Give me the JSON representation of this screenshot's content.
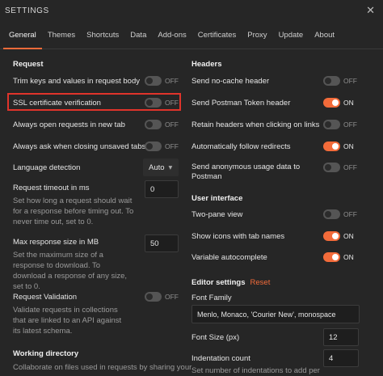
{
  "window": {
    "title": "SETTINGS",
    "close": "✕"
  },
  "tabs": [
    {
      "label": "General"
    },
    {
      "label": "Themes"
    },
    {
      "label": "Shortcuts"
    },
    {
      "label": "Data"
    },
    {
      "label": "Add-ons"
    },
    {
      "label": "Certificates"
    },
    {
      "label": "Proxy"
    },
    {
      "label": "Update"
    },
    {
      "label": "About"
    }
  ],
  "left": {
    "request_heading": "Request",
    "trim_keys": {
      "label": "Trim keys and values in request body",
      "state": "OFF"
    },
    "ssl": {
      "label": "SSL certificate verification",
      "state": "OFF"
    },
    "open_new_tab": {
      "label": "Always open requests in new tab",
      "state": "OFF"
    },
    "ask_closing": {
      "label": "Always ask when closing unsaved tabs",
      "state": "OFF"
    },
    "language_detection": {
      "label": "Language detection",
      "value": "Auto",
      "arrow": "▾"
    },
    "timeout": {
      "label": "Request timeout in ms",
      "desc": "Set how long a request should wait for a response before timing out. To never time out, set to 0.",
      "value": "0"
    },
    "max_response": {
      "label": "Max response size in MB",
      "desc": "Set the maximum size of a response to download. To download a response of any size, set to 0.",
      "value": "50"
    },
    "validation": {
      "label": "Request Validation",
      "desc": "Validate requests in collections that are linked to an API against its latest schema.",
      "state": "OFF"
    },
    "working_dir_heading": "Working directory",
    "working_dir_desc": "Collaborate on files used in requests by sharing your"
  },
  "right": {
    "headers_heading": "Headers",
    "no_cache": {
      "label": "Send no-cache header",
      "state": "OFF"
    },
    "postman_token": {
      "label": "Send Postman Token header",
      "state": "ON"
    },
    "retain_headers": {
      "label": "Retain headers when clicking on links",
      "state": "OFF"
    },
    "follow_redirects": {
      "label": "Automatically follow redirects",
      "state": "ON"
    },
    "anonymous_usage": {
      "label": "Send anonymous usage data to Postman",
      "state": "OFF"
    },
    "ui_heading": "User interface",
    "two_pane": {
      "label": "Two-pane view",
      "state": "OFF"
    },
    "show_icons": {
      "label": "Show icons with tab names",
      "state": "ON"
    },
    "variable_autocomplete": {
      "label": "Variable autocomplete",
      "state": "ON"
    },
    "editor_heading": "Editor settings",
    "reset_label": "Reset",
    "font_family": {
      "label": "Font Family",
      "value": "Menlo, Monaco, 'Courier New', monospace"
    },
    "font_size": {
      "label": "Font Size (px)",
      "value": "12"
    },
    "indentation": {
      "label": "Indentation count",
      "value": "4",
      "desc": "Set number of indentations to add per"
    }
  },
  "colors": {
    "accent": "#f26b3a",
    "highlight": "#e0342b",
    "background": "#262626"
  }
}
